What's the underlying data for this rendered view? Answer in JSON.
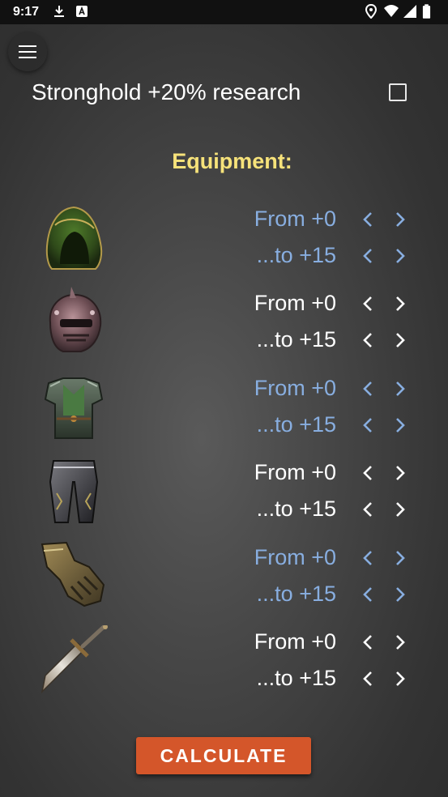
{
  "statusbar": {
    "time": "9:17",
    "icons_left": [
      "download-icon",
      "a-badge-icon"
    ],
    "icons_right": [
      "location-icon",
      "wifi-icon",
      "signal-icon",
      "battery-icon"
    ]
  },
  "menu": {
    "icon": "hamburger-icon"
  },
  "stronghold": {
    "label": "Stronghold +20% research",
    "checked": false
  },
  "equipment": {
    "title": "Equipment:",
    "items": [
      {
        "name": "hood",
        "from_label": "From +0",
        "to_label": "...to +15",
        "color": "blue"
      },
      {
        "name": "helmet",
        "from_label": "From +0",
        "to_label": "...to +15",
        "color": "white"
      },
      {
        "name": "armor",
        "from_label": "From +0",
        "to_label": "...to +15",
        "color": "blue"
      },
      {
        "name": "greaves",
        "from_label": "From +0",
        "to_label": "...to +15",
        "color": "white"
      },
      {
        "name": "gauntlets",
        "from_label": "From +0",
        "to_label": "...to +15",
        "color": "blue"
      },
      {
        "name": "sword",
        "from_label": "From +0",
        "to_label": "...to +15",
        "color": "white"
      }
    ]
  },
  "calculate": {
    "label": "CALCULATE"
  },
  "colors": {
    "accent": "#d4562a",
    "title": "#f6e27a",
    "blue_text": "#88aee0"
  }
}
